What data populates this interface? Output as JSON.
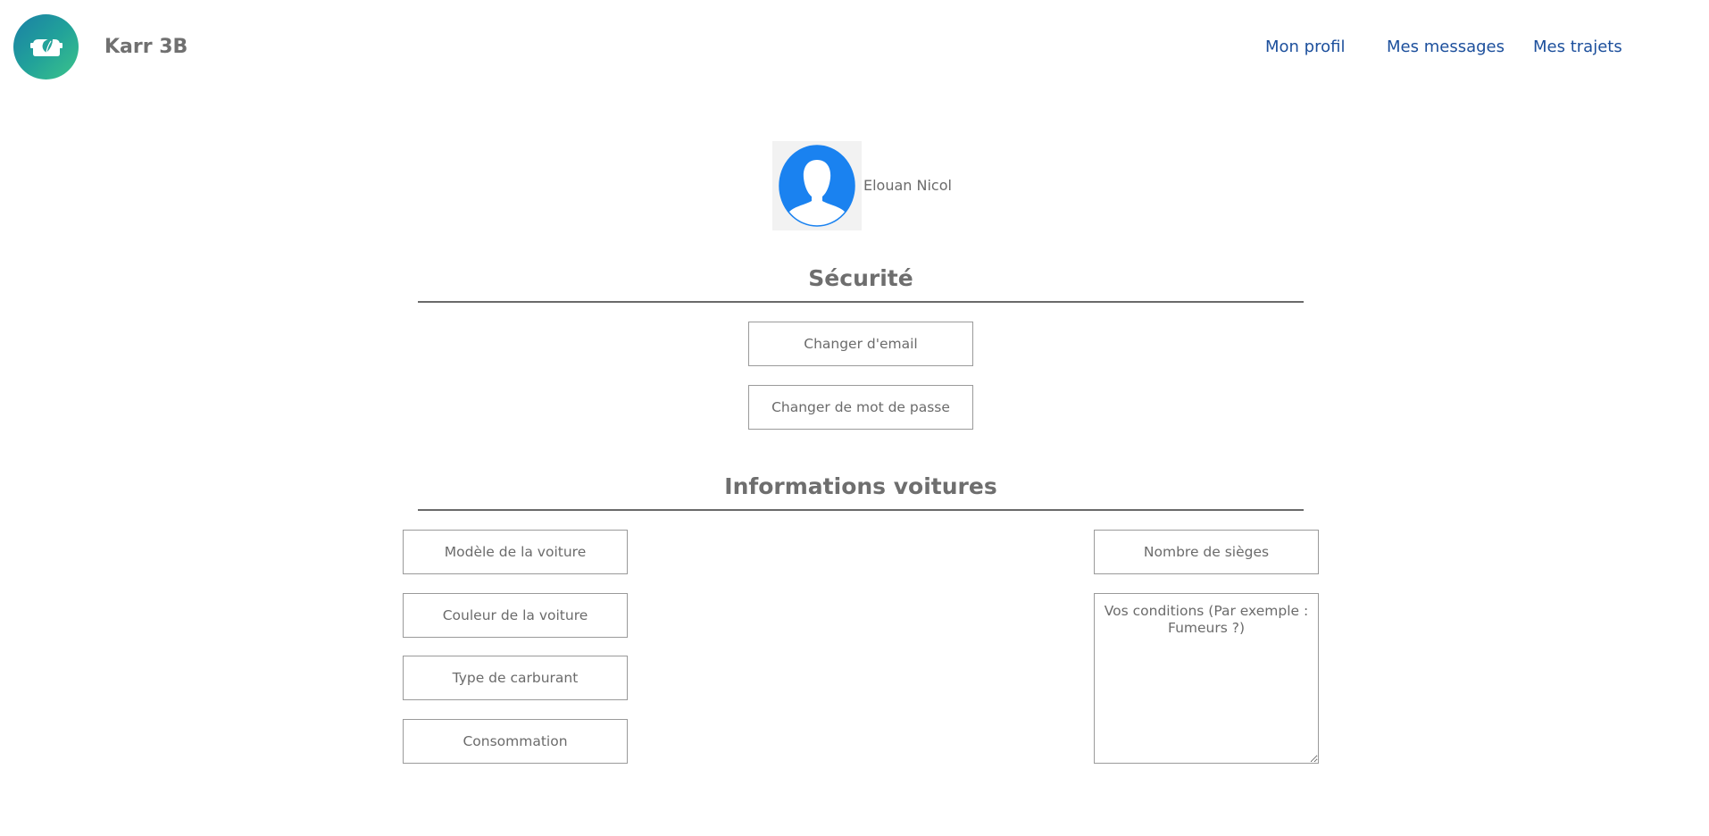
{
  "header": {
    "brand": "Karr 3B",
    "nav": {
      "profile": "Mon profil",
      "messages": "Mes messages",
      "trips": "Mes trajets"
    }
  },
  "profile": {
    "name": "Elouan Nicol"
  },
  "security": {
    "title": "Sécurité",
    "change_email": "Changer d'email",
    "change_password": "Changer de mot de passe"
  },
  "cars": {
    "title": "Informations voitures",
    "model_placeholder": "Modèle de la voiture",
    "color_placeholder": "Couleur de la voiture",
    "fuel_placeholder": "Type de carburant",
    "consumption_placeholder": "Consommation",
    "seats_placeholder": "Nombre de sièges",
    "conditions_placeholder": "Vos conditions (Par exemple : Fumeurs ?)"
  },
  "colors": {
    "nav_link": "#1c4f9c",
    "avatar_blue": "#1a82f0",
    "logo_gradient_start": "#1a7fa6",
    "logo_gradient_end": "#3cc48a"
  },
  "icons": {
    "logo": "car-leaf-logo-icon",
    "avatar": "user-silhouette-icon"
  }
}
